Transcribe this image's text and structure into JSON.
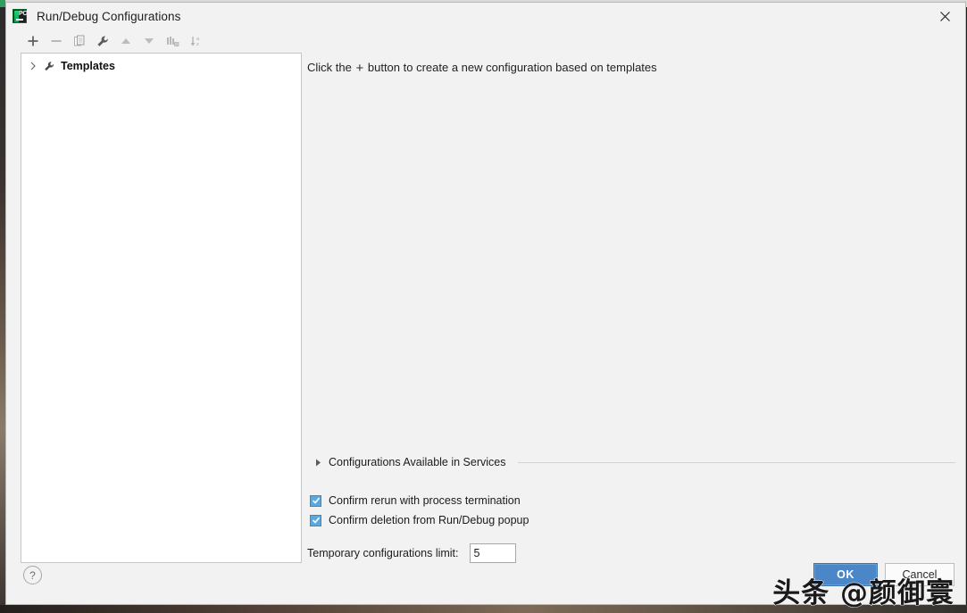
{
  "window": {
    "title": "Run/Debug Configurations",
    "app_icon": "pycharm-icon",
    "app_icon_text": "PC",
    "close_label": "✕"
  },
  "toolbar": {
    "buttons": [
      {
        "name": "add-configuration-button",
        "icon": "plus-icon",
        "label": "+"
      },
      {
        "name": "remove-configuration-button",
        "icon": "minus-icon",
        "label": "−"
      },
      {
        "name": "copy-configuration-button",
        "icon": "copy-icon",
        "label": "Copy"
      },
      {
        "name": "edit-templates-button",
        "icon": "wrench-icon",
        "label": "Edit Templates"
      },
      {
        "name": "move-up-button",
        "icon": "arrow-up-icon",
        "label": "Move Up"
      },
      {
        "name": "move-down-button",
        "icon": "arrow-down-icon",
        "label": "Move Down"
      },
      {
        "name": "move-into-folder-button",
        "icon": "folder-icon",
        "label": "Move into new folder"
      },
      {
        "name": "sort-configurations-button",
        "icon": "sort-az-icon",
        "label": "Sort configurations"
      }
    ]
  },
  "tree": {
    "items": [
      {
        "label": "Templates",
        "icon": "wrench-icon",
        "chevron": "›",
        "expanded": false
      }
    ]
  },
  "main": {
    "hint_prefix": "Click the",
    "hint_plus": "+",
    "hint_suffix": "button to create a new configuration based on templates"
  },
  "section": {
    "triangle": "▸",
    "label": "Configurations Available in Services",
    "expanded": false
  },
  "options": {
    "checkboxes": [
      {
        "label": "Confirm rerun with process termination",
        "checked": true,
        "name": "confirm-rerun-checkbox"
      },
      {
        "label": "Confirm deletion from Run/Debug popup",
        "checked": true,
        "name": "confirm-deletion-checkbox"
      }
    ],
    "limit_label": "Temporary configurations limit:",
    "limit_value": "5"
  },
  "footer": {
    "help_label": "?",
    "ok_label": "OK",
    "cancel_label": "Cancel"
  },
  "overlay": {
    "watermark": "头条 @颜御寰"
  },
  "colors": {
    "accent": "#4a86c8",
    "checkbox": "#5ba8e0",
    "dialog_bg": "#f2f2f2",
    "panel_bg": "#ffffff"
  }
}
